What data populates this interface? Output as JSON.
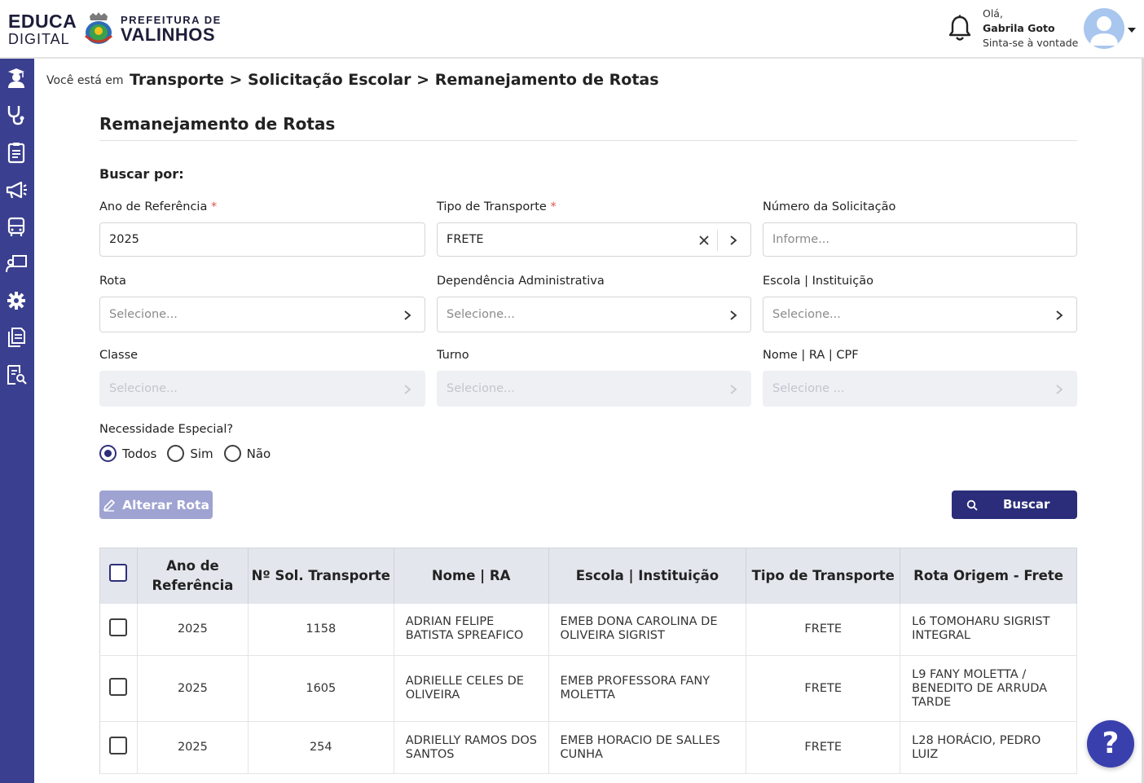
{
  "header": {
    "logo_educa_line1": "EDUCA",
    "logo_educa_line2": "DIGITAL",
    "logo_pref_line1": "PREFEITURA DE",
    "logo_pref_line2": "VALINHOS",
    "greeting": "Olá,",
    "user_name": "Gabrila Goto",
    "tagline": "Sinta-se à vontade"
  },
  "sidebar": {
    "items": [
      {
        "icon": "graduation-icon"
      },
      {
        "icon": "stethoscope-icon"
      },
      {
        "icon": "clipboard-icon"
      },
      {
        "icon": "megaphone-icon"
      },
      {
        "icon": "bus-icon"
      },
      {
        "icon": "teacher-board-icon"
      },
      {
        "icon": "gear-icon"
      },
      {
        "icon": "documents-icon"
      },
      {
        "icon": "report-search-icon"
      }
    ]
  },
  "breadcrumb": {
    "prefix": "Você está em",
    "path": "Transporte > Solicitação Escolar > Remanejamento de Rotas"
  },
  "page": {
    "title": "Remanejamento de Rotas",
    "search_heading": "Buscar por:"
  },
  "filters": {
    "ano": {
      "label": "Ano de Referência",
      "required": "*",
      "value": "2025"
    },
    "tipo": {
      "label": "Tipo de Transporte",
      "required": "*",
      "value": "FRETE"
    },
    "numero": {
      "label": "Número da Solicitação",
      "placeholder": "Informe..."
    },
    "rota": {
      "label": "Rota",
      "placeholder": "Selecione..."
    },
    "dependencia": {
      "label": "Dependência Administrativa",
      "placeholder": "Selecione..."
    },
    "escola": {
      "label": "Escola | Instituição",
      "placeholder": "Selecione..."
    },
    "classe": {
      "label": "Classe",
      "placeholder": "Selecione..."
    },
    "turno": {
      "label": "Turno",
      "placeholder": "Selecione..."
    },
    "nome": {
      "label": "Nome | RA | CPF",
      "placeholder": "Selecione ..."
    },
    "necessidade": {
      "label": "Necessidade Especial?",
      "options": [
        "Todos",
        "Sim",
        "Não"
      ],
      "selected": "Todos"
    }
  },
  "actions": {
    "alterar_label": "Alterar Rota",
    "buscar_label": "Buscar"
  },
  "table": {
    "headers": [
      "Ano de Referência",
      "Nº Sol. Transporte",
      "Nome | RA",
      "Escola | Instituição",
      "Tipo de Transporte",
      "Rota Origem - Frete"
    ],
    "rows": [
      {
        "ano": "2025",
        "sol": "1158",
        "nome": "ADRIAN FELIPE BATISTA SPREAFICO",
        "escola": "EMEB DONA CAROLINA DE OLIVEIRA SIGRIST",
        "tipo": "FRETE",
        "rota": "L6 TOMOHARU SIGRIST INTEGRAL"
      },
      {
        "ano": "2025",
        "sol": "1605",
        "nome": "ADRIELLE CELES DE OLIVEIRA",
        "escola": "EMEB PROFESSORA FANY MOLETTA",
        "tipo": "FRETE",
        "rota": "L9 FANY MOLETTA / BENEDITO DE ARRUDA TARDE"
      },
      {
        "ano": "2025",
        "sol": "254",
        "nome": "ADRIELLY RAMOS DOS SANTOS",
        "escola": "EMEB HORACIO DE SALLES CUNHA",
        "tipo": "FRETE",
        "rota": "L28 HORÁCIO, PEDRO LUIZ"
      }
    ]
  },
  "help": {
    "label": "?"
  },
  "colors": {
    "sidebar": "#3a3f8f",
    "primary_button": "#2b2d7a",
    "disabled_button": "#9ea3d2",
    "table_header_bg": "#e3e6ec",
    "required": "#d9534f"
  }
}
